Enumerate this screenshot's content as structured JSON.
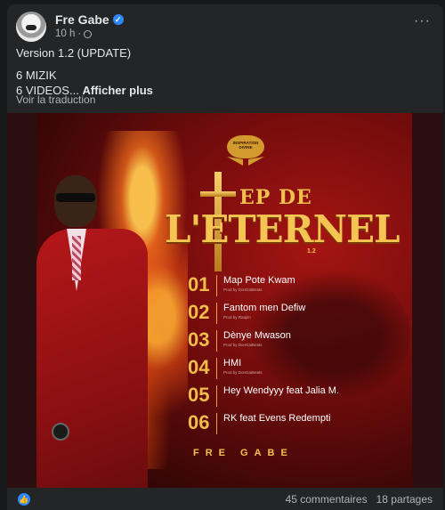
{
  "post": {
    "author": "Fre Gabe",
    "time": "10 h",
    "lines": [
      "Version 1.2 (UPDATE)",
      "6 MIZIK",
      "6 VIDEOS..."
    ],
    "see_more": "Afficher plus",
    "translate": "Voir la traduction"
  },
  "poster": {
    "logo_text": "INSPIRATION DIVINE",
    "title_top": "EP DE",
    "title_main": "L'ETERNEL",
    "title_version": "1.2",
    "artist": "FRE GABE",
    "tracks": [
      {
        "num": "01",
        "title": "Map Pote Kwam",
        "prod": "Prod by DonGaiBeats"
      },
      {
        "num": "02",
        "title": "Fantom men Defiw",
        "prod": "Prod by Raajim"
      },
      {
        "num": "03",
        "title": "Dènye Mwason",
        "prod": "Prod by DonGaiBeats"
      },
      {
        "num": "04",
        "title": "HMI",
        "prod": "Prod by DonGaiBeats"
      },
      {
        "num": "05",
        "title": "Hey Wendyyy feat Jalia M.",
        "prod": ""
      },
      {
        "num": "06",
        "title": "RK feat Evens Redempti",
        "prod": ""
      }
    ]
  },
  "footer": {
    "comments": "45 commentaires",
    "shares": "18 partages"
  },
  "colors": {
    "accent": "#2d88ff",
    "gold": "#f0bd4a"
  }
}
